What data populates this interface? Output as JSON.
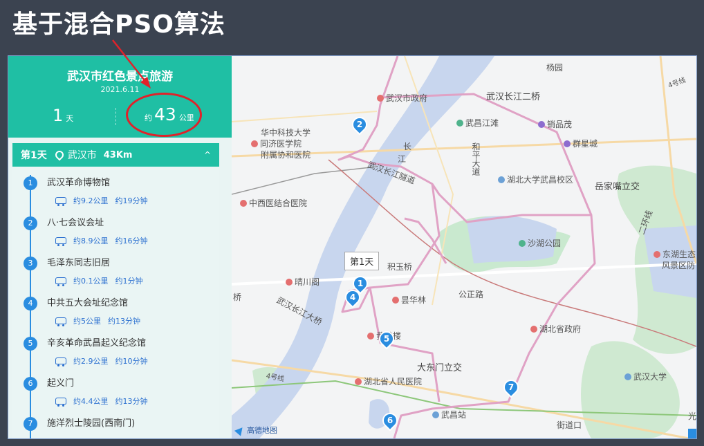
{
  "slide": {
    "title": "基于混合PSO算法"
  },
  "summary": {
    "title": "武汉市红色景点旅游",
    "date": "2021.6.11",
    "days_value": "1",
    "days_unit": "天",
    "dist_prefix": "约",
    "dist_value": "43",
    "dist_unit": "公里"
  },
  "day": {
    "label": "第1天",
    "city": "武汉市",
    "km": "43Km",
    "toggle": "^"
  },
  "stops": [
    {
      "num": "1",
      "name": "武汉革命博物馆",
      "dist": "约9.2公里",
      "time": "约19分钟"
    },
    {
      "num": "2",
      "name": "八·七会议会址",
      "dist": "约8.9公里",
      "time": "约16分钟"
    },
    {
      "num": "3",
      "name": "毛泽东同志旧居",
      "dist": "约0.1公里",
      "time": "约1分钟"
    },
    {
      "num": "4",
      "name": "中共五大会址纪念馆",
      "dist": "约5公里",
      "time": "约13分钟"
    },
    {
      "num": "5",
      "name": "辛亥革命武昌起义纪念馆",
      "dist": "约2.9公里",
      "time": "约10分钟"
    },
    {
      "num": "6",
      "name": "起义门",
      "dist": "约4.4公里",
      "time": "约13分钟"
    },
    {
      "num": "7",
      "name": "施洋烈士陵园(西南门)"
    }
  ],
  "map": {
    "tooltip": "第1天",
    "logo": "高德地图",
    "markers": [
      "1",
      "2",
      "4",
      "5",
      "6",
      "7"
    ],
    "labels": {
      "yangyuan": "杨园",
      "bridge2": "武汉长江二桥",
      "gov": "武汉市政府",
      "jiangtan": "武昌江滩",
      "pinmao": "销品茂",
      "qunxing": "群星城",
      "tongji1": "华中科技大学",
      "tongji2": "同济医学院",
      "tongji3": "附属协和医院",
      "changjiang": "长",
      "jiang": "江",
      "heping": "和平大道",
      "wuda": "湖北大学武昌校区",
      "yuejia": "岳家嘴立交",
      "zhongxi": "中西医结合医院",
      "bridge_rd": "武汉长江隧道",
      "shahu": "沙湖公园",
      "erhuan": "二环线",
      "east_lake1": "东湖生态",
      "east_lake2": "风景区防",
      "jiyuqiao": "积玉桥",
      "qingchuan": "晴川阁",
      "qiao": "桥",
      "wuhan_bridge": "武汉长江大桥",
      "tanhualin": "昙华林",
      "gongzheng": "公正路",
      "hubei_gov": "湖北省政府",
      "huanghelou": "黄鹤楼",
      "dadongmen": "大东门立交",
      "hubei_hosp": "湖北省人民医院",
      "wuda_univ": "武汉大学",
      "wuchang": "武昌站",
      "jiedaokou": "街道口",
      "ring4": "4号线",
      "ring4b": "4号线",
      "guang": "光"
    }
  }
}
